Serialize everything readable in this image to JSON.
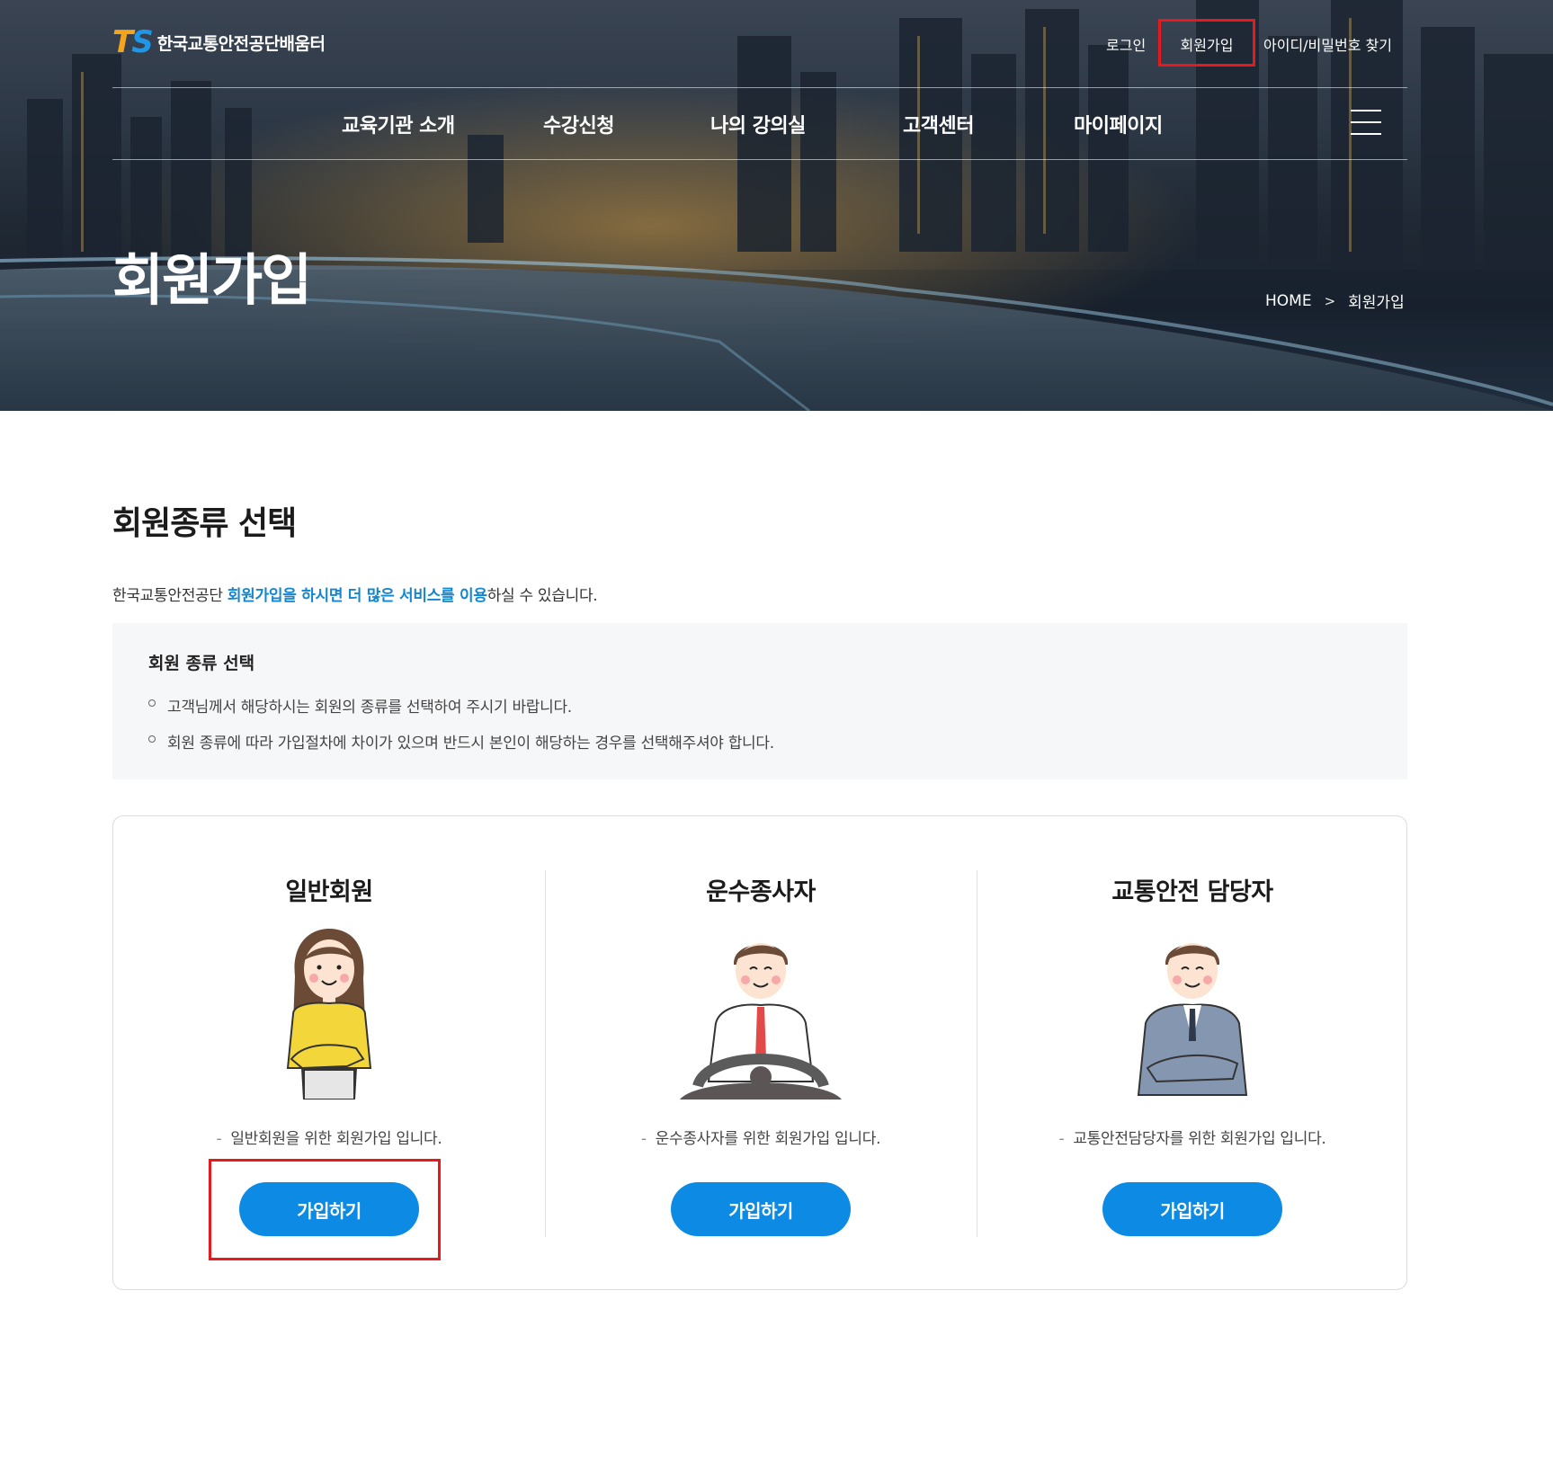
{
  "header": {
    "logo_mark_t": "T",
    "logo_mark_s": "S",
    "logo_text": "한국교통안전공단배움터",
    "util": {
      "login": "로그인",
      "join": "회원가입",
      "find": "아이디/비밀번호 찾기"
    },
    "nav": [
      "교육기관 소개",
      "수강신청",
      "나의 강의실",
      "고객센터",
      "마이페이지"
    ]
  },
  "hero": {
    "title": "회원가입",
    "breadcrumb": {
      "home": "HOME",
      "chevron": ">",
      "current": "회원가입"
    }
  },
  "main": {
    "section_title": "회원종류 선택",
    "intro": {
      "prefix": "한국교통안전공단 ",
      "highlight": "회원가입을 하시면 더 많은 서비스를 이용",
      "suffix": "하실 수 있습니다."
    },
    "notice": {
      "title": "회원 종류 선택",
      "items": [
        "고객님께서 해당하시는 회원의 종류를 선택하여 주시기 바랍니다.",
        "회원 종류에 따라 가입절차에 차이가 있으며 반드시 본인이 해당하는 경우를 선택해주셔야 합니다."
      ]
    },
    "cards": [
      {
        "title": "일반회원",
        "dash": "-",
        "desc": "일반회원을 위한 회원가입 입니다.",
        "button": "가입하기"
      },
      {
        "title": "운수종사자",
        "dash": "-",
        "desc": "운수종사자를 위한 회원가입 입니다.",
        "button": "가입하기"
      },
      {
        "title": "교통안전 담당자",
        "dash": "-",
        "desc": "교통안전담당자를 위한 회원가입 입니다.",
        "button": "가입하기"
      }
    ]
  },
  "colors": {
    "accent": "#0d8ae3",
    "highlight_text": "#1486cf",
    "annotation_red": "#e8191d",
    "logo_orange": "#f3a51b",
    "logo_blue": "#1f97e6"
  }
}
